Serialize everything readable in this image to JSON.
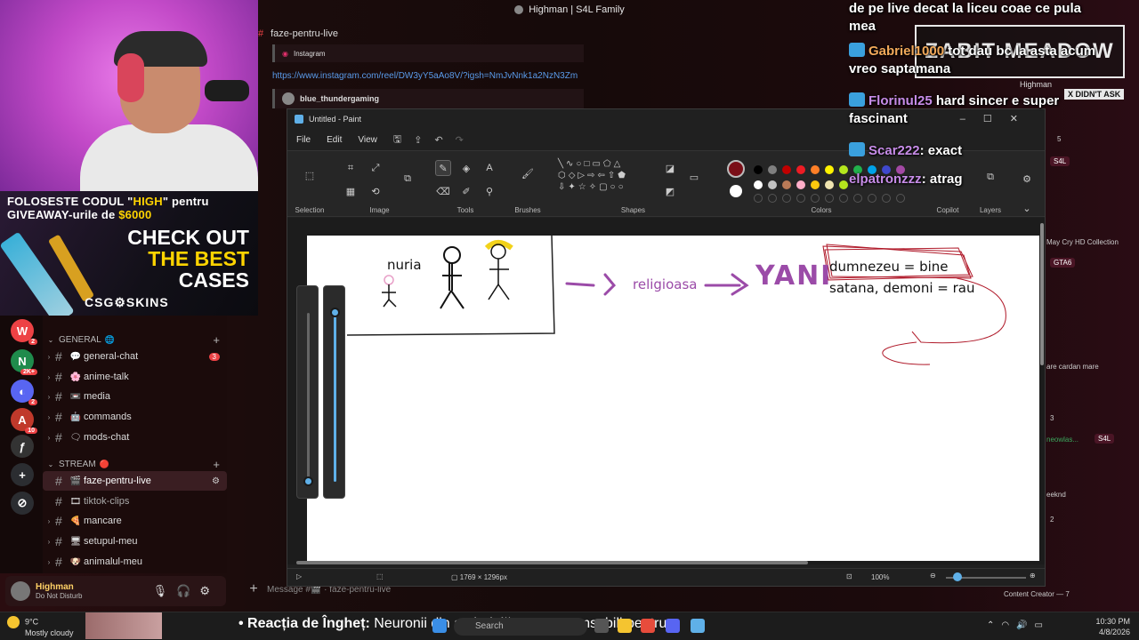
{
  "top_title": "Highman | S4L Family",
  "stream": {
    "ad_promo_prefix": "FOLOSESTE CODUL ",
    "ad_code": "HIGH",
    "ad_promo_mid": " pentru GIVEAWAY-urile de ",
    "ad_amount": "$6000",
    "ad_line1": "CHECK OUT",
    "ad_line2": "THE BEST",
    "ad_line3": "CASES",
    "ad_brand": "CSG⚙SKINS"
  },
  "discord": {
    "channel_header": "faze-pentru-live",
    "embed1_author": "Instagram",
    "link": "https://www.instagram.com/reel/DW3yY5aAo8V/?igsh=NmJvNnk1a2NzN3Zm",
    "embed2_author": "blue_thundergaming",
    "categories": [
      {
        "label": "GENERAL",
        "icon": "🌐"
      },
      {
        "label": "STREAM",
        "icon": "🔴"
      }
    ],
    "general_channels": [
      {
        "name": "general-chat",
        "emoji": "💬",
        "mentions": "3"
      },
      {
        "name": "anime-talk",
        "emoji": "🌸",
        "mentions": ""
      },
      {
        "name": "media",
        "emoji": "📼",
        "mentions": ""
      },
      {
        "name": "commands",
        "emoji": "🤖",
        "mentions": ""
      },
      {
        "name": "mods-chat",
        "emoji": "🗨",
        "mentions": ""
      }
    ],
    "stream_channels": [
      {
        "name": "faze-pentru-live",
        "emoji": "🎬",
        "active": true
      },
      {
        "name": "tiktok-clips",
        "emoji": "🎞"
      },
      {
        "name": "mancare",
        "emoji": "🍕"
      },
      {
        "name": "setupul-meu",
        "emoji": "🖥"
      },
      {
        "name": "animalul-meu",
        "emoji": "🐶"
      }
    ],
    "user": {
      "name": "Highman",
      "status": "Do Not Disturb"
    },
    "message_placeholder": "Message #🎬 · faze-pentru-live",
    "servers": [
      {
        "glyph": "W",
        "color": "#ed4245",
        "badge": "2"
      },
      {
        "glyph": "N",
        "color": "#1f8b4c",
        "badge": "2K+"
      },
      {
        "glyph": "◐",
        "color": "#5865f2",
        "badge": "2"
      },
      {
        "glyph": "A",
        "color": "#c0392b",
        "badge": "10"
      },
      {
        "glyph": "ƒ",
        "color": "#333333",
        "badge": ""
      },
      {
        "glyph": "+",
        "color": "#2b2d31",
        "badge": ""
      },
      {
        "glyph": "⊘",
        "color": "#2b2d31",
        "badge": ""
      }
    ]
  },
  "paint": {
    "title": "Untitled - Paint",
    "menu": [
      "File",
      "Edit",
      "View"
    ],
    "groups": {
      "selection": "Selection",
      "image": "Image",
      "tools": "Tools",
      "brushes": "Brushes",
      "shapes": "Shapes",
      "colors": "Colors",
      "copilot": "Copilot",
      "layers": "Layers"
    },
    "palette_row1": [
      "#000000",
      "#7f7f7f",
      "#c00000",
      "#ed1c24",
      "#ff7f27",
      "#fff200",
      "#b5e61d",
      "#22b14c",
      "#00a2e8",
      "#3f48cc",
      "#a349a4"
    ],
    "palette_row2": [
      "#ffffff",
      "#c3c3c3",
      "#b97a57",
      "#ffaec9",
      "#ffc90e",
      "#efe4b0",
      "#b5e61d"
    ],
    "primary_color": "#7a0f18",
    "canvas_size": "1769 × 1296px",
    "zoom": "100%",
    "drawing": {
      "label_nuria": "nuria",
      "label_religioasa": "religioasa",
      "label_yani": "YANI",
      "label_bine": "dumnezeu = bine",
      "label_rau": "satana, demoni = rau"
    }
  },
  "chat_overlay": [
    {
      "user": "",
      "text": "de pe live decat la liceu coae ce pula mea",
      "ucolor": "#ffffff"
    },
    {
      "user": "Gabriel1000",
      "text": " tot dau bc la asta acum vreo saptamana",
      "ucolor": "#f2a95a"
    },
    {
      "user": "Florinul25",
      "text": " hard sincer e super fascinant",
      "ucolor": "#c78ce8"
    },
    {
      "user": "Scar222",
      "text": " exact",
      "ucolor": "#c78ce8"
    },
    {
      "user": "elpatronzzz",
      "text": " atrag",
      "ucolor": "#c78ce8"
    }
  ],
  "overlay_sign": "ZABIT MEADOW",
  "overlay_tag": "X DIDN'T ASK",
  "overlay_user": "Highman",
  "right_col": {
    "num1": "5",
    "tag1": "S4L",
    "text1": "May Cry HD Collection",
    "tag2": "GTA6",
    "text2": "are cardan mare",
    "num2": "3",
    "text3": "neowlas...",
    "tag3": "S4L",
    "text4": "eeknd",
    "num3": "2",
    "text5": "Content Creator — 7"
  },
  "taskbar": {
    "temp": "9°C",
    "weather": "Mostly cloudy",
    "ticker_bold": "Reacția de Îngheț:",
    "ticker_text": " Neuronii din amigdală sunt responsabili pentru",
    "search": "Search",
    "time": "10:30 PM",
    "date": "4/8/2026"
  }
}
